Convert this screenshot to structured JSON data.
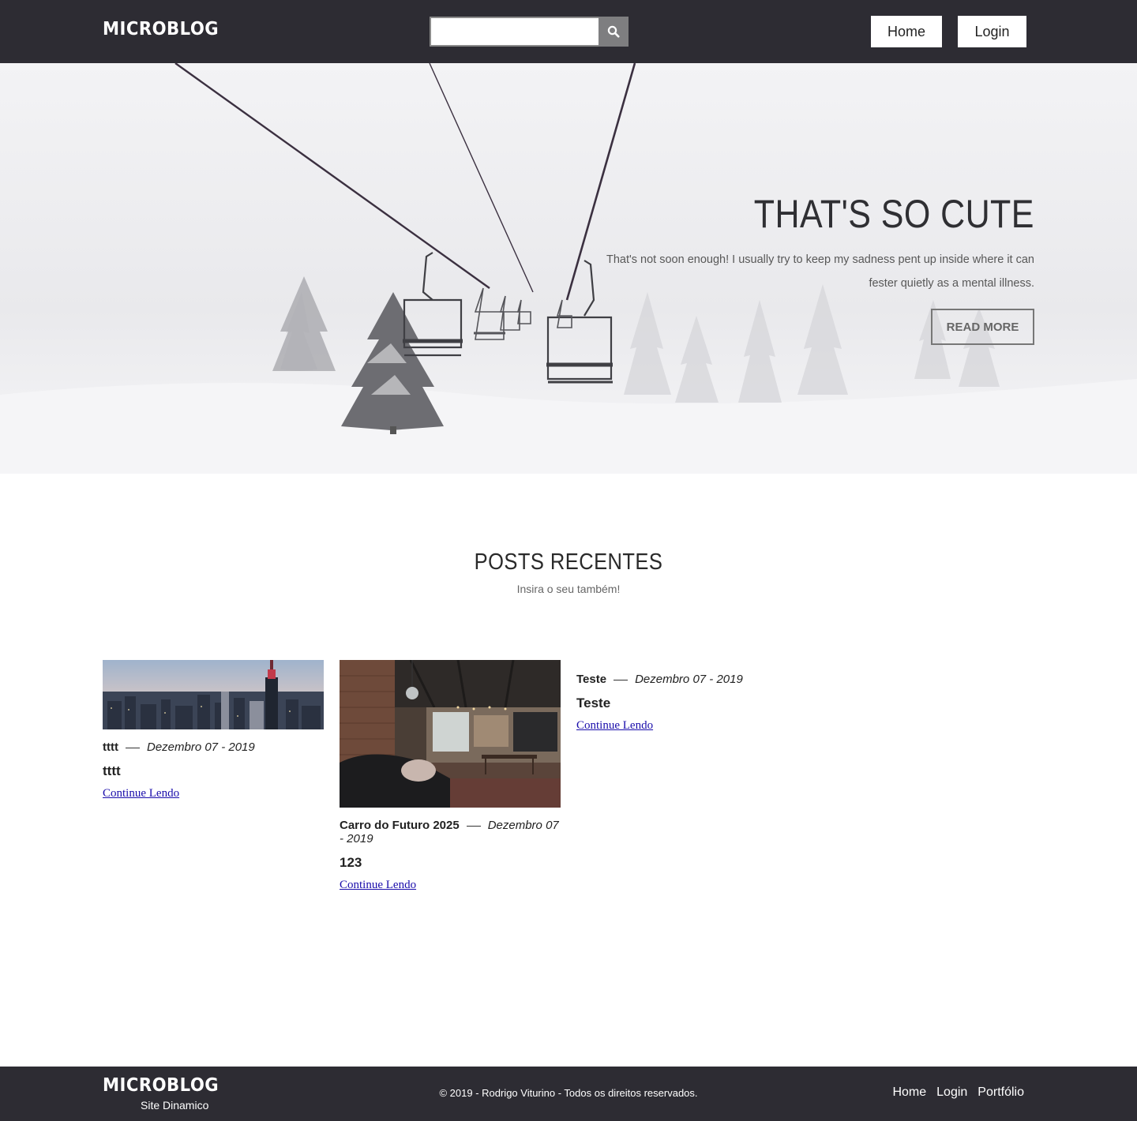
{
  "header": {
    "brand": "MICROBLOG",
    "search": {
      "placeholder": "",
      "value": ""
    },
    "nav": [
      {
        "label": "Home"
      },
      {
        "label": "Login"
      }
    ]
  },
  "hero": {
    "title": "THAT'S SO CUTE",
    "text": "That's not soon enough! I usually try to keep my sadness pent up inside where it can fester quietly as a mental illness.",
    "button": "READ MORE"
  },
  "posts_section": {
    "title": "POSTS RECENTES",
    "subtitle": "Insira o seu também!",
    "posts": [
      {
        "author": "tttt",
        "date": "Dezembro 07 - 2019",
        "title": "tttt",
        "link": "Continue Lendo",
        "image": "city-skyline"
      },
      {
        "author": "Carro do Futuro 2025",
        "date": "Dezembro 07 - 2019",
        "title": "123",
        "link": "Continue Lendo",
        "image": "loft-interior"
      },
      {
        "author": "Teste",
        "date": "Dezembro 07 - 2019",
        "title": "Teste",
        "link": "Continue Lendo",
        "image": ""
      }
    ]
  },
  "footer": {
    "brand": "MICROBLOG",
    "tagline": "Site Dinamico",
    "copyright": "© 2019 - Rodrigo Viturino - Todos os direitos reservados.",
    "nav": [
      {
        "label": "Home"
      },
      {
        "label": "Login"
      },
      {
        "label": "Portfólio"
      }
    ]
  },
  "colors": {
    "header_bg": "#2d2c33",
    "footer_bg": "#2d2c33",
    "link": "#1a0dab",
    "search_button": "#7e7e80"
  }
}
